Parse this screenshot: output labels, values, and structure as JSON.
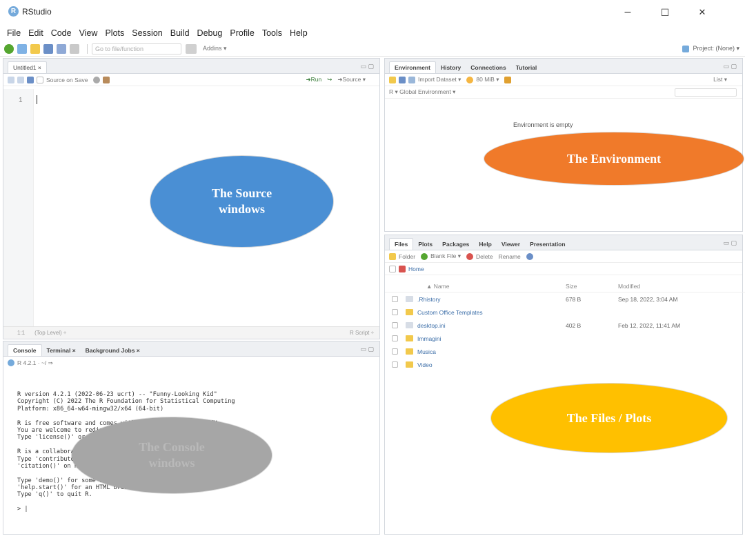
{
  "window": {
    "title": "RStudio",
    "logo_letter": "R",
    "controls": {
      "minimize": "–",
      "maximize": "☐",
      "close": "✕"
    }
  },
  "menu": [
    "File",
    "Edit",
    "Code",
    "View",
    "Plots",
    "Session",
    "Build",
    "Debug",
    "Profile",
    "Tools",
    "Help"
  ],
  "toolbar": {
    "goto_placeholder": "Go to file/function",
    "addins": "Addins ▾",
    "project": "Project: (None) ▾"
  },
  "source": {
    "tab": "Untitled1 ×",
    "source_on_save": "Source on Save",
    "run": "➜Run",
    "source": "➜Source ▾",
    "line_number": "1",
    "status_position": "1:1",
    "status_level": "(Top Level) ÷",
    "status_type": "R Script ÷"
  },
  "console": {
    "tabs": [
      "Console",
      "Terminal ×",
      "Background Jobs ×"
    ],
    "path": "R 4.2.1 · ~/ ⇒",
    "lines": [
      "R version 4.2.1 (2022-06-23 ucrt) -- \"Funny-Looking Kid\"",
      "Copyright (C) 2022 The R Foundation for Statistical Computing",
      "Platform: x86_64-w64-mingw32/x64 (64-bit)",
      "",
      "R is free software and comes with ABSOLUTELY NO WARRANTY.",
      "You are welcome to redistribute it under certain conditions.",
      "Type 'license()' or 'licence()' for distribution details.",
      "",
      "R is a collaborative project with many contributors.",
      "Type 'contributors()' for more information and",
      "'citation()' on how to cite R or R packages in publications.",
      "",
      "Type 'demo()' for some demos, 'help()' for on-line help, or",
      "'help.start()' for an HTML browser interface to help.",
      "Type 'q()' to quit R.",
      "",
      "> |"
    ]
  },
  "environment": {
    "tabs": [
      "Environment",
      "History",
      "Connections",
      "Tutorial"
    ],
    "toolbar": {
      "import": "Import Dataset ▾",
      "memory": "80 MiB ▾",
      "view": "List ▾"
    },
    "scope": "R ▾   Global Environment ▾",
    "empty_text": "Environment is empty"
  },
  "files": {
    "tabs": [
      "Files",
      "Plots",
      "Packages",
      "Help",
      "Viewer",
      "Presentation"
    ],
    "toolbar": {
      "folder": "Folder",
      "blank_file": "Blank File ▾",
      "delete": "Delete",
      "rename": "Rename"
    },
    "breadcrumb": "Home",
    "columns": [
      "▲ Name",
      "Size",
      "Modified"
    ],
    "rows": [
      {
        "name": ".Rhistory",
        "size": "678 B",
        "modified": "Sep 18, 2022, 3:04 AM",
        "kind": "file"
      },
      {
        "name": "Custom Office Templates",
        "size": "",
        "modified": "",
        "kind": "folder"
      },
      {
        "name": "desktop.ini",
        "size": "402 B",
        "modified": "Feb 12, 2022, 11:41 AM",
        "kind": "file"
      },
      {
        "name": "Immagini",
        "size": "",
        "modified": "",
        "kind": "folder"
      },
      {
        "name": "Musica",
        "size": "",
        "modified": "",
        "kind": "folder"
      },
      {
        "name": "Video",
        "size": "",
        "modified": "",
        "kind": "folder"
      }
    ]
  },
  "annotations": {
    "source": {
      "line1": "The Source",
      "line2": "windows",
      "color": "#4a8fd4"
    },
    "environment": {
      "text": "The Environment",
      "color": "#f07a2a"
    },
    "files": {
      "text": "The Files / Plots",
      "color": "#ffc000"
    },
    "console": {
      "line1": "The Console",
      "line2": "windows",
      "color": "#a6a6a6"
    }
  },
  "colors": {
    "pane_border": "#d4d8de",
    "link": "#3c6ea8",
    "folder": "#f2c94c"
  }
}
